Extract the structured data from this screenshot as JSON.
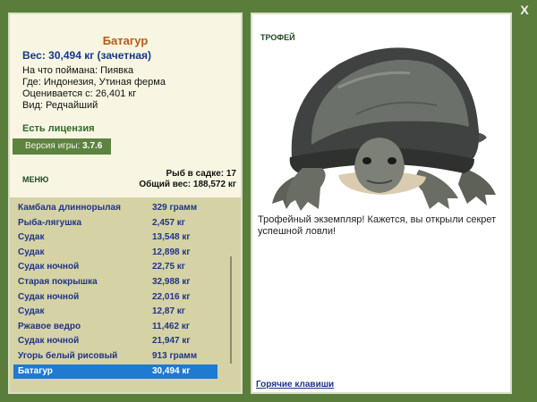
{
  "window": {
    "close_label": "X"
  },
  "catch": {
    "name": "Батагур",
    "weight_line": "Вес: 30,494 кг (зачетная)",
    "bait_line": "На что поймана: Пиявка",
    "place_line": "Где: Индонезия, Утиная ферма",
    "value_line": "Оценивается с: 26,401 кг",
    "rarity_line": "Вид: Редчайший"
  },
  "license": "Есть лицензия",
  "version": {
    "label": "Версия игры:",
    "value": "3.7.6"
  },
  "menu_label": "МЕНЮ",
  "keepnet": {
    "count_line": "Рыб в садке: 17",
    "total_line": "Общий вес: 188,572 кг",
    "items": [
      {
        "name": "Камбала длиннорылая",
        "weight": "329 грамм"
      },
      {
        "name": "Рыба-лягушка",
        "weight": "2,457 кг"
      },
      {
        "name": "Судак",
        "weight": "13,548 кг"
      },
      {
        "name": "Судак",
        "weight": "12,898 кг"
      },
      {
        "name": "Судак ночной",
        "weight": "22,75 кг"
      },
      {
        "name": "Старая покрышка",
        "weight": "32,988 кг"
      },
      {
        "name": "Судак ночной",
        "weight": "22,016 кг"
      },
      {
        "name": "Судак",
        "weight": "12,87 кг"
      },
      {
        "name": "Ржавое ведро",
        "weight": "11,462 кг"
      },
      {
        "name": "Судак ночной",
        "weight": "21,947 кг"
      },
      {
        "name": "Угорь белый рисовый",
        "weight": "913 грамм"
      },
      {
        "name": "Батагур",
        "weight": "30,494 кг"
      }
    ],
    "selected_index": 11
  },
  "trophy": {
    "label": "ТРОФЕЙ",
    "description": "Трофейный экземпляр! Кажется, вы открыли секрет успешной ловли!",
    "image_icon": "turtle-icon"
  },
  "hotkeys_label": "Горячие клавиши"
}
